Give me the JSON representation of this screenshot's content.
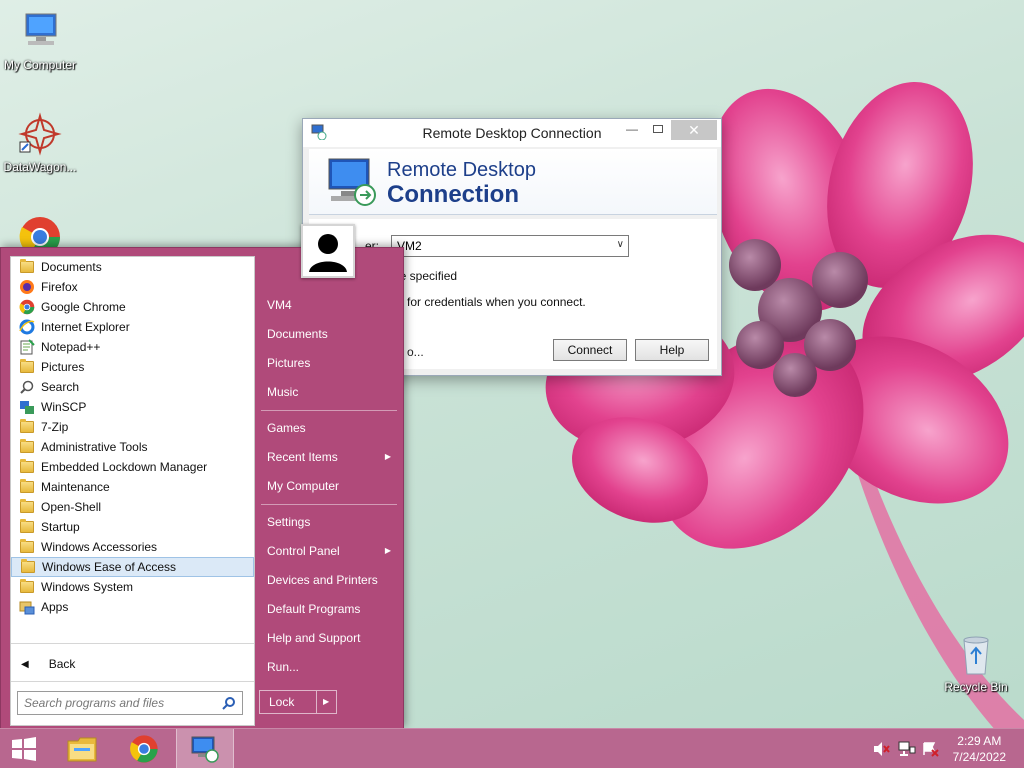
{
  "desktop": {
    "icons": [
      {
        "label": "My Computer",
        "icon": "computer-icon"
      },
      {
        "label": "DataWagon...",
        "icon": "datawagon-icon"
      },
      {
        "label": "Google Chrome",
        "icon": "chrome-icon"
      },
      {
        "label": "Recycle Bin",
        "icon": "recycle-bin-icon"
      }
    ]
  },
  "rdc": {
    "title": "Remote Desktop Connection",
    "banner_line1": "Remote Desktop",
    "banner_line2": "Connection",
    "computer_label": "er:",
    "computer_value": "VM2",
    "user_text": "ne specified",
    "credentials_text": "for credentials when you connect.",
    "options_text": "o...",
    "connect_label": "Connect",
    "help_label": "Help"
  },
  "start_menu": {
    "programs": [
      {
        "label": "Documents",
        "icon": "folder-docs-icon"
      },
      {
        "label": "Firefox",
        "icon": "firefox-icon"
      },
      {
        "label": "Google Chrome",
        "icon": "chrome-icon"
      },
      {
        "label": "Internet Explorer",
        "icon": "ie-icon"
      },
      {
        "label": "Notepad++",
        "icon": "notepadpp-icon"
      },
      {
        "label": "Pictures",
        "icon": "folder-pictures-icon"
      },
      {
        "label": "Search",
        "icon": "search-icon"
      },
      {
        "label": "WinSCP",
        "icon": "winscp-icon"
      },
      {
        "label": "7-Zip",
        "icon": "folder-icon"
      },
      {
        "label": "Administrative Tools",
        "icon": "folder-icon"
      },
      {
        "label": "Embedded Lockdown Manager",
        "icon": "folder-icon"
      },
      {
        "label": "Maintenance",
        "icon": "folder-icon"
      },
      {
        "label": "Open-Shell",
        "icon": "folder-icon"
      },
      {
        "label": "Startup",
        "icon": "folder-icon"
      },
      {
        "label": "Windows Accessories",
        "icon": "folder-icon"
      },
      {
        "label": "Windows Ease of Access",
        "icon": "folder-icon"
      },
      {
        "label": "Windows System",
        "icon": "folder-icon"
      },
      {
        "label": "Apps",
        "icon": "apps-icon"
      }
    ],
    "selected_index": 15,
    "back_label": "Back",
    "search_placeholder": "Search programs and files",
    "right_items": [
      {
        "label": "VM4",
        "submenu": false
      },
      {
        "label": "Documents",
        "submenu": false
      },
      {
        "label": "Pictures",
        "submenu": false
      },
      {
        "label": "Music",
        "submenu": false
      },
      {
        "label": "Games",
        "submenu": false
      },
      {
        "label": "Recent Items",
        "submenu": true
      },
      {
        "label": "My Computer",
        "submenu": false
      },
      {
        "label": "Settings",
        "submenu": false
      },
      {
        "label": "Control Panel",
        "submenu": true
      },
      {
        "label": "Devices and Printers",
        "submenu": false
      },
      {
        "label": "Default Programs",
        "submenu": false
      },
      {
        "label": "Help and Support",
        "submenu": false
      },
      {
        "label": "Run...",
        "submenu": false
      }
    ],
    "lock_label": "Lock"
  },
  "taskbar": {
    "time": "2:29 AM",
    "date": "7/24/2022"
  },
  "colors": {
    "start_menu_bg": "#b04a7a",
    "taskbar_bg": "#b8678f",
    "selection": "#dbe9f7"
  }
}
